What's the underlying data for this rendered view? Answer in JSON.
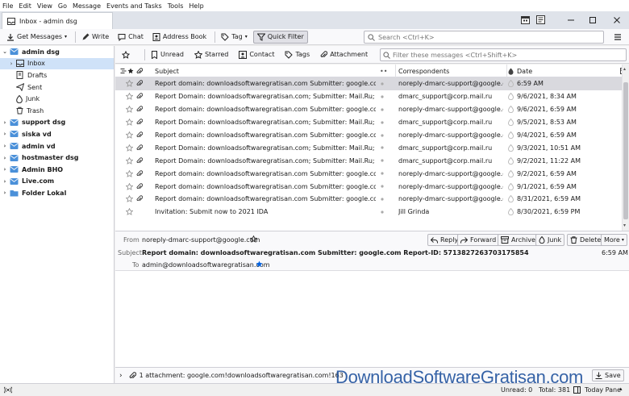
{
  "menubar": {
    "items": [
      "File",
      "Edit",
      "View",
      "Go",
      "Message",
      "Events and Tasks",
      "Tools",
      "Help"
    ]
  },
  "tab": {
    "title": "Inbox - admin dsg"
  },
  "toolbar": {
    "get_messages": "Get Messages",
    "write": "Write",
    "chat": "Chat",
    "address_book": "Address Book",
    "tag": "Tag",
    "quick_filter": "Quick Filter",
    "search_placeholder": "Search <Ctrl+K>"
  },
  "folders": [
    {
      "label": "admin dsg",
      "type": "account",
      "twisty": "⌄"
    },
    {
      "label": "Inbox",
      "type": "inbox",
      "twisty": "›"
    },
    {
      "label": "Drafts",
      "type": "drafts",
      "twisty": ""
    },
    {
      "label": "Sent",
      "type": "sent",
      "twisty": ""
    },
    {
      "label": "Junk",
      "type": "junk",
      "twisty": ""
    },
    {
      "label": "Trash",
      "type": "trash",
      "twisty": ""
    },
    {
      "label": "support dsg",
      "type": "account",
      "twisty": "›"
    },
    {
      "label": "siska vd",
      "type": "account",
      "twisty": "›"
    },
    {
      "label": "admin vd",
      "type": "account",
      "twisty": "›"
    },
    {
      "label": "hostmaster dsg",
      "type": "account",
      "twisty": "›"
    },
    {
      "label": "Admin BHO",
      "type": "account",
      "twisty": "›"
    },
    {
      "label": "Live.com",
      "type": "account",
      "twisty": "›"
    },
    {
      "label": "Folder Lokal",
      "type": "local",
      "twisty": "›"
    }
  ],
  "quickfilter": {
    "unread": "Unread",
    "starred": "Starred",
    "contact": "Contact",
    "tags": "Tags",
    "attachment": "Attachment",
    "filter_placeholder": "Filter these messages <Ctrl+Shift+K>"
  },
  "columns": {
    "subject": "Subject",
    "correspondents": "Correspondents",
    "date": "Date"
  },
  "messages": [
    {
      "subject": "Report domain: downloadsoftwaregratisan.com Submitter: google.com Rep...",
      "from": "noreply-dmarc-support@google.c...",
      "date": "6:59 AM",
      "attach": true
    },
    {
      "subject": "Report Domain: downloadsoftwaregratisan.com; Submitter: Mail.Ru; Report-I...",
      "from": "dmarc_support@corp.mail.ru",
      "date": "9/6/2021, 8:34 AM",
      "attach": true
    },
    {
      "subject": "Report domain: downloadsoftwaregratisan.com Submitter: google.com Rep...",
      "from": "noreply-dmarc-support@google.c...",
      "date": "9/6/2021, 6:59 AM",
      "attach": true
    },
    {
      "subject": "Report Domain: downloadsoftwaregratisan.com; Submitter: Mail.Ru; Report-I...",
      "from": "dmarc_support@corp.mail.ru",
      "date": "9/5/2021, 8:53 AM",
      "attach": true
    },
    {
      "subject": "Report domain: downloadsoftwaregratisan.com Submitter: google.com Rep...",
      "from": "noreply-dmarc-support@google.c...",
      "date": "9/4/2021, 6:59 AM",
      "attach": true
    },
    {
      "subject": "Report Domain: downloadsoftwaregratisan.com; Submitter: Mail.Ru; Report-I...",
      "from": "dmarc_support@corp.mail.ru",
      "date": "9/3/2021, 10:51 AM",
      "attach": true
    },
    {
      "subject": "Report Domain: downloadsoftwaregratisan.com; Submitter: Mail.Ru; Report-I...",
      "from": "dmarc_support@corp.mail.ru",
      "date": "9/2/2021, 11:22 AM",
      "attach": true
    },
    {
      "subject": "Report domain: downloadsoftwaregratisan.com Submitter: google.com Rep...",
      "from": "noreply-dmarc-support@google.c...",
      "date": "9/2/2021, 6:59 AM",
      "attach": true
    },
    {
      "subject": "Report domain: downloadsoftwaregratisan.com Submitter: google.com Rep...",
      "from": "noreply-dmarc-support@google.c...",
      "date": "9/1/2021, 6:59 AM",
      "attach": true
    },
    {
      "subject": "Report domain: downloadsoftwaregratisan.com Submitter: google.com Rep...",
      "from": "noreply-dmarc-support@google.c...",
      "date": "8/31/2021, 6:59 AM",
      "attach": true
    },
    {
      "subject": "Invitation: Submit now to 2021 IDA",
      "from": "Jill Grinda",
      "date": "8/30/2021, 6:59 PM",
      "attach": false
    }
  ],
  "preview": {
    "from_label": "From",
    "from_value": "noreply-dmarc-support@google.com",
    "subject_label": "Subject",
    "subject_value": "Report domain: downloadsoftwaregratisan.com Submitter: google.com Report-ID: 5713827263703175854",
    "to_label": "To",
    "to_value": "admin@downloadsoftwaregratisan.com",
    "time": "6:59 AM",
    "reply": "Reply",
    "forward": "Forward",
    "archive": "Archive",
    "junk": "Junk",
    "delete": "Delete",
    "more": "More"
  },
  "attachment": {
    "text": "1 attachment: google.com!downloadsoftwaregratisan.com!163",
    "save": "Save"
  },
  "status": {
    "unread": "Unread: 0",
    "total": "Total: 381",
    "today_pane": "Today Pane"
  },
  "watermark": "DownloadSoftwareGratisan.com",
  "colors": {
    "accent": "#0061e0",
    "selection": "#cfe2f8",
    "folder": "#f5c542",
    "account": "#4a90d9"
  }
}
